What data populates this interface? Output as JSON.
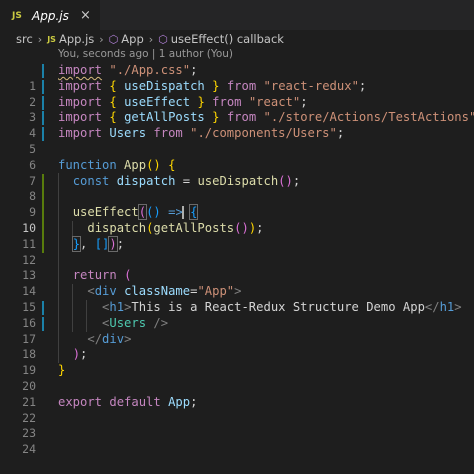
{
  "tab": {
    "lang": "JS",
    "filename": "App.js",
    "close": "×"
  },
  "breadcrumb": {
    "folder": "src",
    "file": "App.js",
    "component": "App",
    "symbol": "useEffect() callback"
  },
  "blame": "You, seconds ago | 1 author (You)",
  "line_numbers": [
    "1",
    "2",
    "3",
    "4",
    "5",
    "6",
    "7",
    "8",
    "9",
    "10",
    "11",
    "12",
    "13",
    "14",
    "15",
    "16",
    "17",
    "18",
    "19",
    "20",
    "21",
    "22",
    "23",
    "24"
  ],
  "code": {
    "import_kw": "import",
    "from_kw": "from",
    "l1_path": "\"./App.css\"",
    "l2_name": "useDispatch",
    "l2_mod": "\"react-redux\"",
    "l3_name": "useEffect",
    "l3_mod": "\"react\"",
    "l4_name": "getAllPosts",
    "l4_mod": "\"./store/Actions/TestActions\"",
    "l5_name": "Users",
    "l5_mod": "\"./components/Users\"",
    "function_kw": "function",
    "app_name": "App",
    "const_kw": "const",
    "dispatch_var": "dispatch",
    "use_dispatch_call": "useDispatch",
    "use_effect_call": "useEffect",
    "dispatch_call": "dispatch",
    "get_all_posts_call": "getAllPosts",
    "return_kw": "return",
    "div_tag": "div",
    "classname_attr": "className",
    "classname_value": "\"App\"",
    "h1_tag": "h1",
    "h1_text": "This is a React-Redux Structure Demo App",
    "users_tag": "Users",
    "export_kw": "export",
    "default_kw": "default",
    "export_name": "App"
  }
}
